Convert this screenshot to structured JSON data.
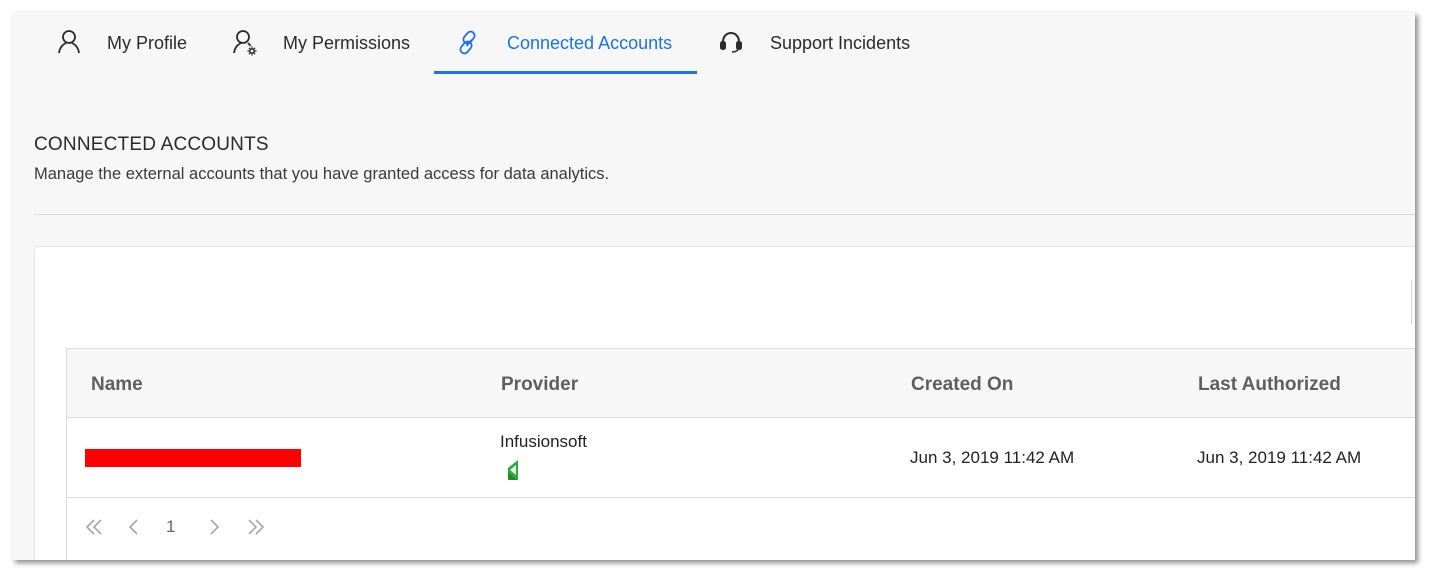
{
  "tabs": [
    {
      "label": "My Profile",
      "icon": "person-icon",
      "active": false
    },
    {
      "label": "My Permissions",
      "icon": "person-gear-icon",
      "active": false
    },
    {
      "label": "Connected Accounts",
      "icon": "link-icon",
      "active": true
    },
    {
      "label": "Support Incidents",
      "icon": "headset-icon",
      "active": false
    }
  ],
  "section": {
    "title": "CONNECTED ACCOUNTS",
    "subtitle": "Manage the external accounts that you have granted access for data analytics."
  },
  "table": {
    "columns": [
      "Name",
      "Provider",
      "Created On",
      "Last Authorized"
    ],
    "rows": [
      {
        "name": "",
        "provider": "Infusionsoft",
        "provider_icon": "infusionsoft-logo",
        "created_on": "Jun 3, 2019 11:42 AM",
        "last_authorized": "Jun 3, 2019 11:42 AM"
      }
    ]
  },
  "pager": {
    "current_page": "1"
  },
  "colors": {
    "accent": "#1a73e8",
    "redaction": "#ff0000",
    "provider_green": "#2eaa3c"
  }
}
